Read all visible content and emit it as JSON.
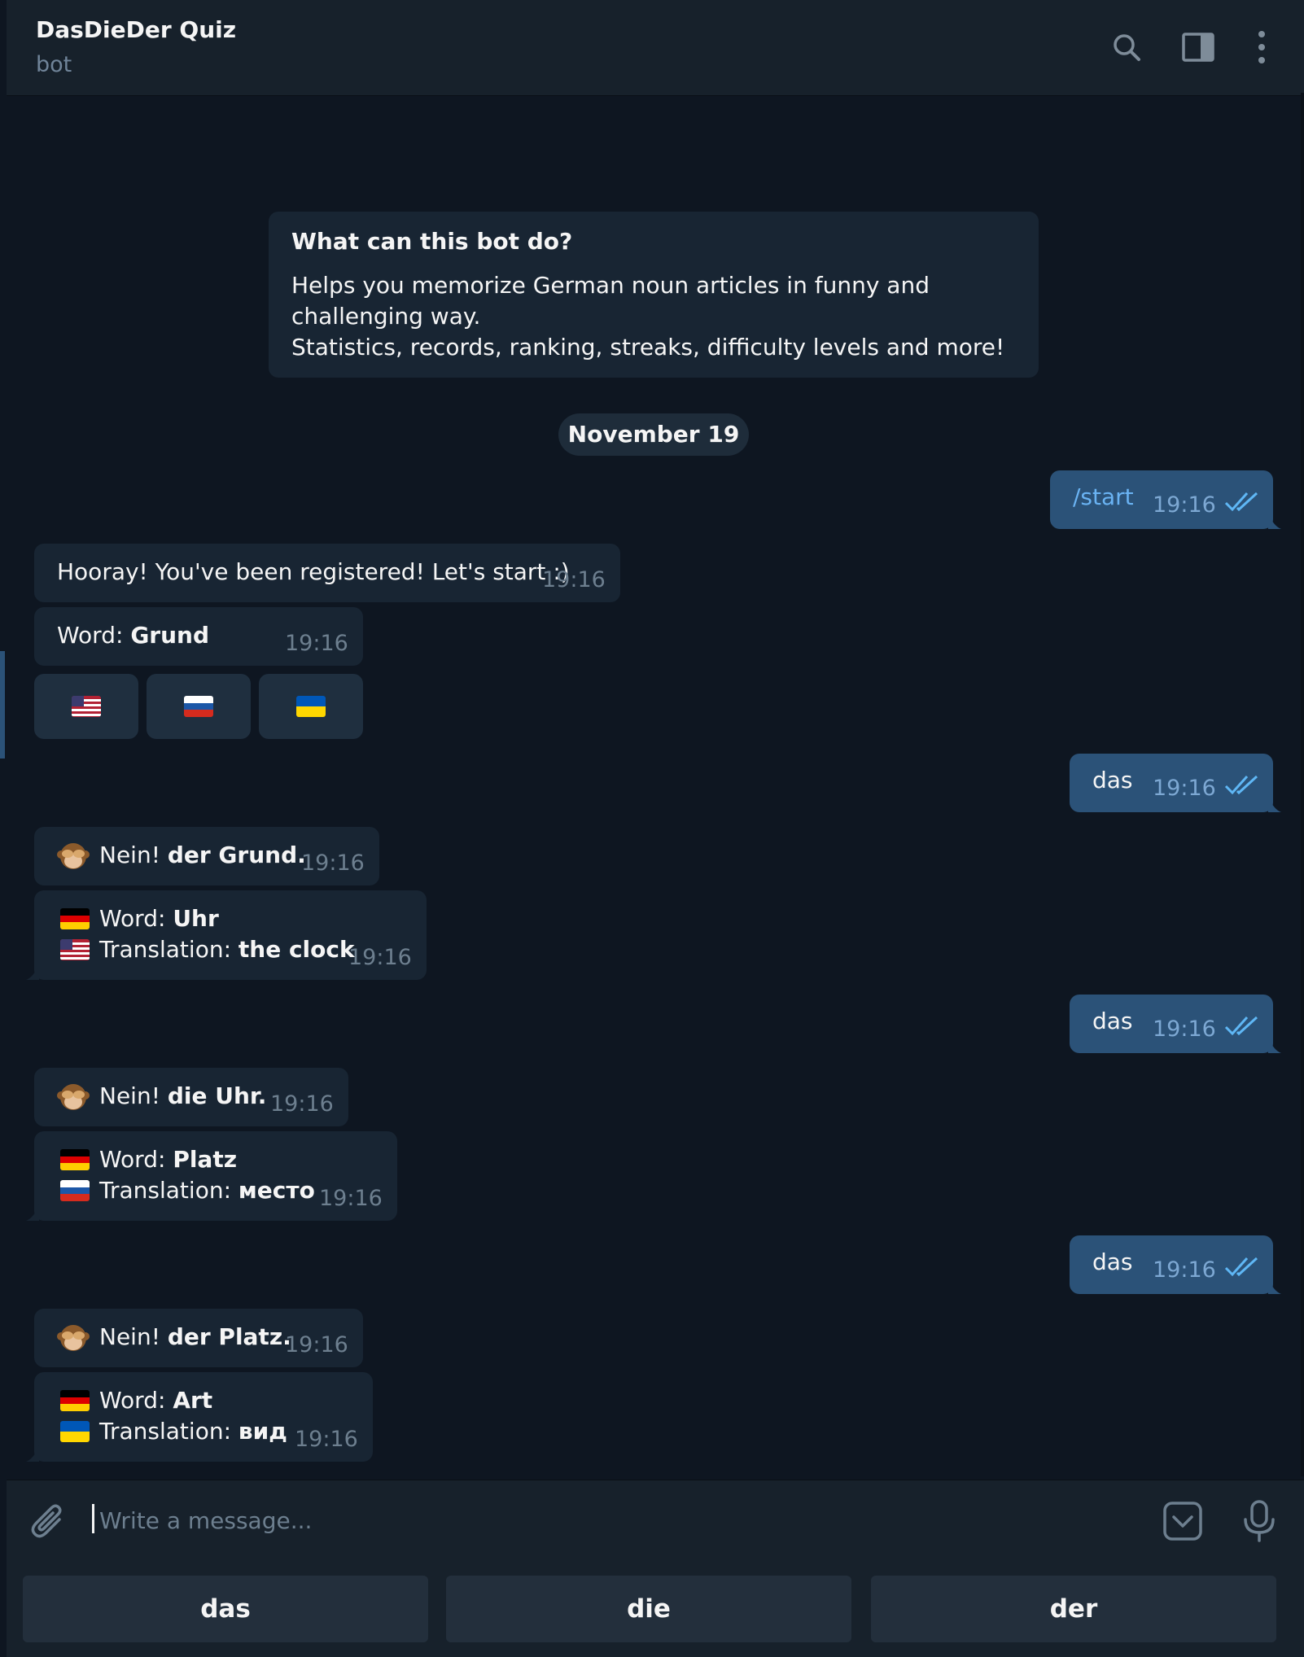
{
  "header": {
    "title": "DasDieDer Quiz",
    "subtitle": "bot"
  },
  "intro": {
    "title": "What can this bot do?",
    "line1": "Helps you memorize German noun articles in funny and challenging way.",
    "line2": "Statistics, records,  ranking, streaks, difficulty levels and more!"
  },
  "date_separator": "November 19",
  "messages": {
    "start": {
      "text": "/start",
      "time": "19:16"
    },
    "registered": {
      "text": "Hooray! You've been registered! Let's start :)",
      "time": "19:16"
    },
    "word1": {
      "prefix": "Word: ",
      "word": "Grund",
      "time": "19:16"
    },
    "das1": {
      "text": "das",
      "time": "19:16"
    },
    "nein1": {
      "prefix": "Nein! ",
      "answer": "der Grund",
      "suffix": ".",
      "time": "19:16"
    },
    "word2": {
      "prefix": "Word: ",
      "word": "Uhr",
      "tr_prefix": "Translation: ",
      "translation": "the clock",
      "time": "19:16"
    },
    "das2": {
      "text": "das",
      "time": "19:16"
    },
    "nein2": {
      "prefix": "Nein! ",
      "answer": "die Uhr",
      "suffix": ".",
      "time": "19:16"
    },
    "word3": {
      "prefix": "Word: ",
      "word": "Platz",
      "tr_prefix": "Translation: ",
      "translation": "место",
      "time": "19:16"
    },
    "das3": {
      "text": "das",
      "time": "19:16"
    },
    "nein3": {
      "prefix": "Nein! ",
      "answer": "der Platz",
      "suffix": ".",
      "time": "19:16"
    },
    "word4": {
      "prefix": "Word: ",
      "word": "Art",
      "tr_prefix": "Translation: ",
      "translation": "вид",
      "time": "19:16"
    }
  },
  "inline_keyboard": [
    "flag-us",
    "flag-ru",
    "flag-ua"
  ],
  "composer": {
    "placeholder": "Write a message..."
  },
  "reply_keyboard": [
    "das",
    "die",
    "der"
  ],
  "colors": {
    "background": "#0e1621",
    "header": "#17212b",
    "incoming_bubble": "#182533",
    "outgoing_bubble": "#2b5278",
    "accent": "#5fb7f5"
  }
}
